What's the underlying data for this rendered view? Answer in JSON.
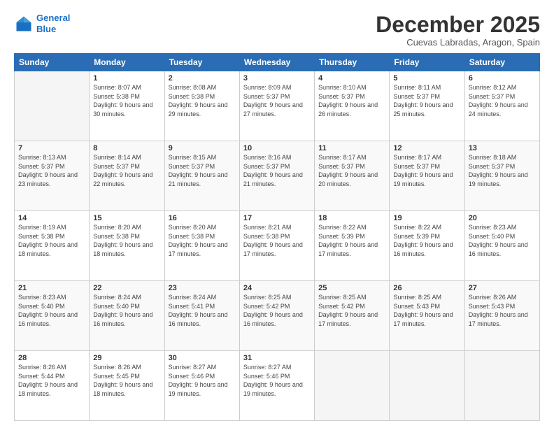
{
  "header": {
    "logo_line1": "General",
    "logo_line2": "Blue",
    "month_title": "December 2025",
    "location": "Cuevas Labradas, Aragon, Spain"
  },
  "days_of_week": [
    "Sunday",
    "Monday",
    "Tuesday",
    "Wednesday",
    "Thursday",
    "Friday",
    "Saturday"
  ],
  "weeks": [
    [
      {
        "day": "",
        "sunrise": "",
        "sunset": "",
        "daylight": "",
        "empty": true
      },
      {
        "day": "1",
        "sunrise": "Sunrise: 8:07 AM",
        "sunset": "Sunset: 5:38 PM",
        "daylight": "Daylight: 9 hours and 30 minutes."
      },
      {
        "day": "2",
        "sunrise": "Sunrise: 8:08 AM",
        "sunset": "Sunset: 5:38 PM",
        "daylight": "Daylight: 9 hours and 29 minutes."
      },
      {
        "day": "3",
        "sunrise": "Sunrise: 8:09 AM",
        "sunset": "Sunset: 5:37 PM",
        "daylight": "Daylight: 9 hours and 27 minutes."
      },
      {
        "day": "4",
        "sunrise": "Sunrise: 8:10 AM",
        "sunset": "Sunset: 5:37 PM",
        "daylight": "Daylight: 9 hours and 26 minutes."
      },
      {
        "day": "5",
        "sunrise": "Sunrise: 8:11 AM",
        "sunset": "Sunset: 5:37 PM",
        "daylight": "Daylight: 9 hours and 25 minutes."
      },
      {
        "day": "6",
        "sunrise": "Sunrise: 8:12 AM",
        "sunset": "Sunset: 5:37 PM",
        "daylight": "Daylight: 9 hours and 24 minutes."
      }
    ],
    [
      {
        "day": "7",
        "sunrise": "Sunrise: 8:13 AM",
        "sunset": "Sunset: 5:37 PM",
        "daylight": "Daylight: 9 hours and 23 minutes."
      },
      {
        "day": "8",
        "sunrise": "Sunrise: 8:14 AM",
        "sunset": "Sunset: 5:37 PM",
        "daylight": "Daylight: 9 hours and 22 minutes."
      },
      {
        "day": "9",
        "sunrise": "Sunrise: 8:15 AM",
        "sunset": "Sunset: 5:37 PM",
        "daylight": "Daylight: 9 hours and 21 minutes."
      },
      {
        "day": "10",
        "sunrise": "Sunrise: 8:16 AM",
        "sunset": "Sunset: 5:37 PM",
        "daylight": "Daylight: 9 hours and 21 minutes."
      },
      {
        "day": "11",
        "sunrise": "Sunrise: 8:17 AM",
        "sunset": "Sunset: 5:37 PM",
        "daylight": "Daylight: 9 hours and 20 minutes."
      },
      {
        "day": "12",
        "sunrise": "Sunrise: 8:17 AM",
        "sunset": "Sunset: 5:37 PM",
        "daylight": "Daylight: 9 hours and 19 minutes."
      },
      {
        "day": "13",
        "sunrise": "Sunrise: 8:18 AM",
        "sunset": "Sunset: 5:37 PM",
        "daylight": "Daylight: 9 hours and 19 minutes."
      }
    ],
    [
      {
        "day": "14",
        "sunrise": "Sunrise: 8:19 AM",
        "sunset": "Sunset: 5:38 PM",
        "daylight": "Daylight: 9 hours and 18 minutes."
      },
      {
        "day": "15",
        "sunrise": "Sunrise: 8:20 AM",
        "sunset": "Sunset: 5:38 PM",
        "daylight": "Daylight: 9 hours and 18 minutes."
      },
      {
        "day": "16",
        "sunrise": "Sunrise: 8:20 AM",
        "sunset": "Sunset: 5:38 PM",
        "daylight": "Daylight: 9 hours and 17 minutes."
      },
      {
        "day": "17",
        "sunrise": "Sunrise: 8:21 AM",
        "sunset": "Sunset: 5:38 PM",
        "daylight": "Daylight: 9 hours and 17 minutes."
      },
      {
        "day": "18",
        "sunrise": "Sunrise: 8:22 AM",
        "sunset": "Sunset: 5:39 PM",
        "daylight": "Daylight: 9 hours and 17 minutes."
      },
      {
        "day": "19",
        "sunrise": "Sunrise: 8:22 AM",
        "sunset": "Sunset: 5:39 PM",
        "daylight": "Daylight: 9 hours and 16 minutes."
      },
      {
        "day": "20",
        "sunrise": "Sunrise: 8:23 AM",
        "sunset": "Sunset: 5:40 PM",
        "daylight": "Daylight: 9 hours and 16 minutes."
      }
    ],
    [
      {
        "day": "21",
        "sunrise": "Sunrise: 8:23 AM",
        "sunset": "Sunset: 5:40 PM",
        "daylight": "Daylight: 9 hours and 16 minutes."
      },
      {
        "day": "22",
        "sunrise": "Sunrise: 8:24 AM",
        "sunset": "Sunset: 5:40 PM",
        "daylight": "Daylight: 9 hours and 16 minutes."
      },
      {
        "day": "23",
        "sunrise": "Sunrise: 8:24 AM",
        "sunset": "Sunset: 5:41 PM",
        "daylight": "Daylight: 9 hours and 16 minutes."
      },
      {
        "day": "24",
        "sunrise": "Sunrise: 8:25 AM",
        "sunset": "Sunset: 5:42 PM",
        "daylight": "Daylight: 9 hours and 16 minutes."
      },
      {
        "day": "25",
        "sunrise": "Sunrise: 8:25 AM",
        "sunset": "Sunset: 5:42 PM",
        "daylight": "Daylight: 9 hours and 17 minutes."
      },
      {
        "day": "26",
        "sunrise": "Sunrise: 8:25 AM",
        "sunset": "Sunset: 5:43 PM",
        "daylight": "Daylight: 9 hours and 17 minutes."
      },
      {
        "day": "27",
        "sunrise": "Sunrise: 8:26 AM",
        "sunset": "Sunset: 5:43 PM",
        "daylight": "Daylight: 9 hours and 17 minutes."
      }
    ],
    [
      {
        "day": "28",
        "sunrise": "Sunrise: 8:26 AM",
        "sunset": "Sunset: 5:44 PM",
        "daylight": "Daylight: 9 hours and 18 minutes."
      },
      {
        "day": "29",
        "sunrise": "Sunrise: 8:26 AM",
        "sunset": "Sunset: 5:45 PM",
        "daylight": "Daylight: 9 hours and 18 minutes."
      },
      {
        "day": "30",
        "sunrise": "Sunrise: 8:27 AM",
        "sunset": "Sunset: 5:46 PM",
        "daylight": "Daylight: 9 hours and 19 minutes."
      },
      {
        "day": "31",
        "sunrise": "Sunrise: 8:27 AM",
        "sunset": "Sunset: 5:46 PM",
        "daylight": "Daylight: 9 hours and 19 minutes."
      },
      {
        "day": "",
        "sunrise": "",
        "sunset": "",
        "daylight": "",
        "empty": true
      },
      {
        "day": "",
        "sunrise": "",
        "sunset": "",
        "daylight": "",
        "empty": true
      },
      {
        "day": "",
        "sunrise": "",
        "sunset": "",
        "daylight": "",
        "empty": true
      }
    ]
  ]
}
